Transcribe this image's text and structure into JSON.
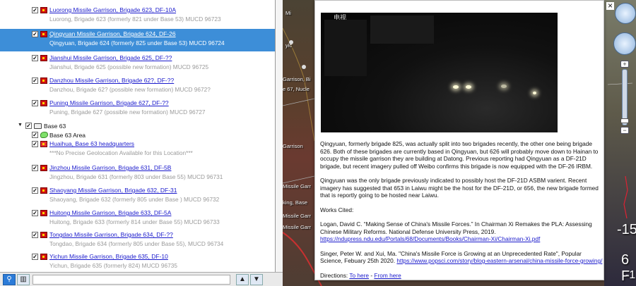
{
  "tree": {
    "items": [
      {
        "title": "Luorong Missile Garrison, Brigade 623, DF-10A",
        "desc": "Luorong, Brigade 623 (formerly 821 under Base 53) MUCD 96723",
        "selected": false
      },
      {
        "title": "Qingyuan Missile Garrison, Brigade 624, DF-26",
        "desc": "Qingyuan, Brigade 624 (formerly 825 under Base 53) MUCD 96724",
        "selected": true
      },
      {
        "title": "Jianshui Missile Garrison, Brigade 625, DF-??",
        "desc": "Jianshui, Brigade 625 (possible new formation) MUCD 96725",
        "selected": false
      },
      {
        "title": "Danzhou Missile Garrison, Brigade 62?, DF-??",
        "desc": "Danzhou, Brigade 62? (possible new formation) MUCD 9672?",
        "selected": false
      },
      {
        "title": "Puning Missile Garrison, Brigade 627, DF-??",
        "desc": "Puning, Brigade 627 (possible new formation) MUCD 96727",
        "selected": false
      }
    ],
    "group": {
      "label": "Base 63"
    },
    "area": {
      "label": "Base 63 Area"
    },
    "hq": {
      "title": "Huaihua, Base 63 headquarters",
      "desc": "***No Precise Geolocation Available for this Location***"
    },
    "base63_items": [
      {
        "title": "Jinzhou Missile Garrison, Brigade 631, DF-5B",
        "desc": "Jingzhou, Brigade 631 (formerly 803 under Base 55) MUCD 96731"
      },
      {
        "title": "Shaoyang Missile Garrison, Brigade 632, DF-31",
        "desc": "Shaoyang, Brigade 632 (formerly 805 under Base ) MUCD 96732"
      },
      {
        "title": "Huitong Missile Garrison, Brigade 633, DF-5A",
        "desc": "Huitong, Brigade 633 (formerly 814 under Base 55) MUCD 96733"
      },
      {
        "title": "Tongdao Missile Garrison, Brigade 634, DF-??",
        "desc": "Tongdao, Brigade 634 (formerly 805 under Base 55), MUCD 96734"
      },
      {
        "title": "Yichun Missile Garrison, Brigade 635, DF-10",
        "desc": "Yichun, Brigade 635 (formerly 824) MUCD 96735"
      }
    ]
  },
  "map": {
    "labels": [
      "Mi",
      "yic",
      "Garrison, Bi",
      "e 67, Nucle",
      "Garrison",
      "Missile Garr",
      "king, Base",
      "Missile Garr",
      "Missile Garr"
    ],
    "big_numbers": [
      "-15",
      "6 F",
      "-1"
    ]
  },
  "balloon": {
    "watermark": "电视",
    "close_symbol": "×",
    "p1": "Qingyuan, formerly brigade 825, was actually split into two brigades recently, the other one being brigade 626. Both of these brigades are currently based in Qingyuan, but 626 will probably move down to Hainan to occupy the missile garrison they are building at Datong. Previous reporting had Qingyuan as a DF-21D brigade, but recent imagery pulled off Weibo confirms this brigade is now equipped with the DF-26 IRBM.",
    "p2": "Qingyuan was the only brigade previously indicated to possibly host the DF-21D ASBM varient. Recent imagery has suggested that 653 in Laiwu might be the host for the DF-21D, or 656, the new brigade formed that is reportly going to be hosted near Laiwu.",
    "works_cited": "Works Cited:",
    "cite1_text": "Logan, David C. “Making Sense of China's Missile Forces.” In Chairman Xi Remakes the PLA: Assessing Chinese Military Reforms. National Defense University Press, 2019.",
    "cite1_link": "https://ndupress.ndu.edu/Portals/68/Documents/Books/Chairman-Xi/Chairman-Xi.pdf",
    "cite2_text": "Singer, Peter W. and Xui, Ma. \"China's Missile Force is Growing at an Unprecedented Rate\", Popular Science, Febuary 25th 2020.",
    "cite2_link": "https://www.popsci.com/story/blog-eastern-arsenal/china-missile-force-growing/",
    "directions_label": "Directions:",
    "to_here": "To here",
    "separator": " - ",
    "from_here": "From here"
  },
  "toolbar": {
    "search_icon": "search-icon",
    "layers_icon": "layers-icon",
    "up": "▲",
    "down": "▼"
  },
  "nav": {
    "plus": "+",
    "minus": "−"
  }
}
